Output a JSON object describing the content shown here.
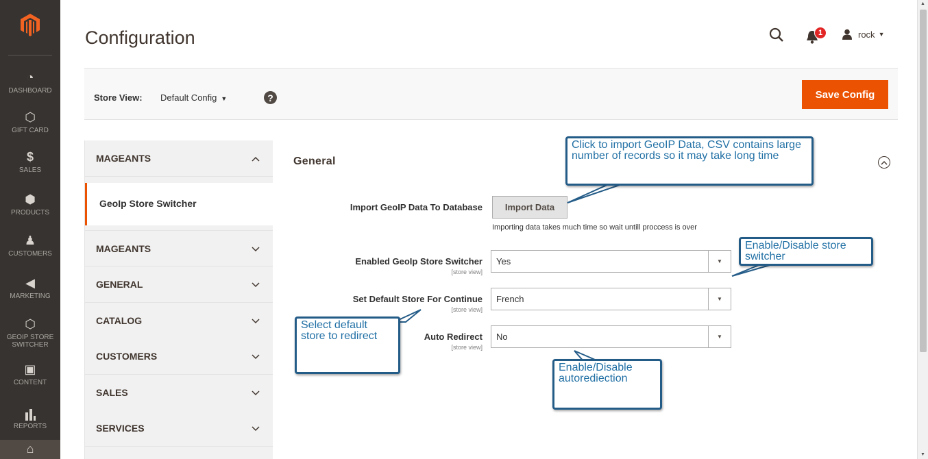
{
  "nav": {
    "items": [
      {
        "label": "DASHBOARD",
        "icon": "dashboard-icon"
      },
      {
        "label": "GIFT CARD",
        "icon": "hexagon-icon"
      },
      {
        "label": "SALES",
        "icon": "dollar-icon"
      },
      {
        "label": "PRODUCTS",
        "icon": "cube-icon"
      },
      {
        "label": "CUSTOMERS",
        "icon": "person-icon"
      },
      {
        "label": "MARKETING",
        "icon": "megaphone-icon"
      },
      {
        "label": "GEOIP STORE SWITCHER",
        "icon": "hexagon-icon"
      },
      {
        "label": "CONTENT",
        "icon": "layout-icon"
      },
      {
        "label": "REPORTS",
        "icon": "bar-chart-icon"
      },
      {
        "label": "",
        "icon": "store-icon"
      }
    ],
    "symbols": {
      "dashboard": "◔",
      "hexagon": "⬡",
      "dollar": "$",
      "cube": "⬢",
      "person": "♟",
      "megaphone": "◀",
      "layout": "▣",
      "reports": "▮",
      "store": "⌂"
    }
  },
  "header": {
    "title": "Configuration",
    "notifications_count": "1",
    "user_name": "rock"
  },
  "scope": {
    "label": "Store View:",
    "value": "Default Config",
    "help": "?",
    "save_label": "Save Config"
  },
  "tabs": {
    "groups": [
      {
        "label": "MAGEANTS",
        "expanded": true
      },
      {
        "label": "MAGEANTS",
        "expanded": false
      },
      {
        "label": "GENERAL",
        "expanded": false
      },
      {
        "label": "CATALOG",
        "expanded": false
      },
      {
        "label": "CUSTOMERS",
        "expanded": false
      },
      {
        "label": "SALES",
        "expanded": false
      },
      {
        "label": "SERVICES",
        "expanded": false
      }
    ],
    "active_link": "GeoIp Store Switcher",
    "chev_up": "^",
    "chev_down": "⌄"
  },
  "section": {
    "title": "General",
    "collapse_symbol": "^"
  },
  "fields": {
    "import_label": "Import GeoIP Data To Database",
    "import_button": "Import Data",
    "import_note": "Importing data takes much time so wait untill proccess is over",
    "enabled_label": "Enabled GeoIp Store Switcher",
    "enabled_value": "Yes",
    "default_store_label": "Set Default Store For Continue",
    "default_store_value": "French",
    "auto_redirect_label": "Auto Redirect",
    "auto_redirect_value": "No",
    "scope_note": "[store view]",
    "select_arrow": "▼"
  },
  "callouts": {
    "import": "Click to import GeoIP Data, CSV contains large number of records so it may take long time",
    "enable": "Enable/Disable store switcher",
    "default_store": "Select default store to redirect",
    "autoredirect": "Enable/Disable autorediection",
    "color": "#2170a5",
    "border": "#245c88"
  },
  "colors": {
    "accent": "#eb5202",
    "sidebar": "#373330",
    "badge": "#e22626"
  }
}
